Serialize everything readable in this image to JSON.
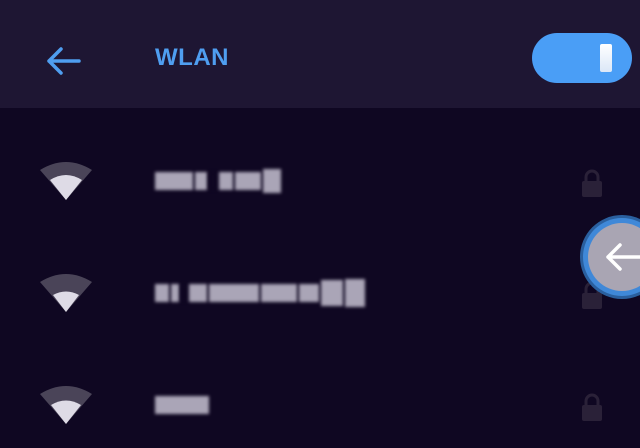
{
  "header": {
    "title": "WLAN",
    "back_icon": "arrow-left-icon",
    "toggle_state": "on"
  },
  "networks": [
    {
      "name": "",
      "signal_icon": "wifi-signal-icon",
      "secured": true
    },
    {
      "name": "",
      "signal_icon": "wifi-signal-icon",
      "secured": true
    },
    {
      "name": "",
      "signal_icon": "wifi-signal-icon",
      "secured": true
    }
  ],
  "floating_button": {
    "icon": "arrow-left-icon"
  },
  "colors": {
    "accent": "#4f9ef0",
    "header_bg": "#1e1633",
    "body_bg": "#0f0722",
    "toggle_bg": "#4a9ef6"
  }
}
